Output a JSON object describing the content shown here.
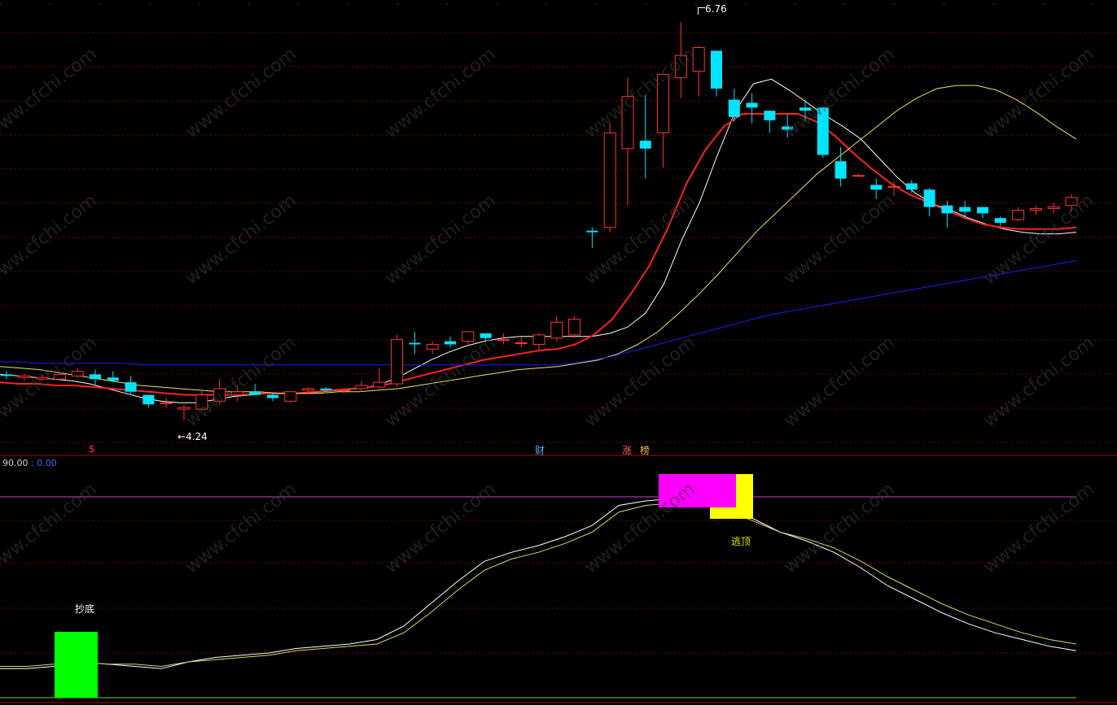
{
  "chart_data": [
    {
      "type": "candlestick",
      "high_label": "6.76",
      "low_label": "4.24",
      "moving_averages": [
        {
          "color": "#ffffff",
          "values": [
            4.53,
            4.52,
            4.51,
            4.5,
            4.49,
            4.47,
            4.44,
            4.41,
            4.38,
            4.36,
            4.35,
            4.35,
            4.37,
            4.39,
            4.4,
            4.41,
            4.41,
            4.41,
            4.42,
            4.43,
            4.44,
            4.46,
            4.5,
            4.56,
            4.62,
            4.67,
            4.71,
            4.74,
            4.76,
            4.77,
            4.77,
            4.77,
            4.77,
            4.77,
            4.79,
            4.83,
            4.92,
            5.1,
            5.38,
            5.62,
            5.92,
            6.2,
            6.37,
            6.4,
            6.33,
            6.25,
            6.17,
            6.1,
            6.02,
            5.9,
            5.78,
            5.68,
            5.61,
            5.57,
            5.52,
            5.48,
            5.45,
            5.43,
            5.42,
            5.42,
            5.43
          ]
        },
        {
          "color": "#ff2020",
          "values": [
            4.48,
            4.47,
            4.47,
            4.46,
            4.46,
            4.45,
            4.44,
            4.43,
            4.42,
            4.41,
            4.4,
            4.4,
            4.4,
            4.4,
            4.41,
            4.41,
            4.41,
            4.42,
            4.43,
            4.44,
            4.45,
            4.47,
            4.5,
            4.53,
            4.56,
            4.59,
            4.62,
            4.64,
            4.66,
            4.68,
            4.69,
            4.72,
            4.78,
            4.88,
            5.04,
            5.22,
            5.46,
            5.74,
            5.95,
            6.1,
            6.18,
            6.18,
            6.18,
            6.18,
            6.13,
            6.04,
            5.93,
            5.83,
            5.74,
            5.67,
            5.62,
            5.57,
            5.52,
            5.48,
            5.46,
            5.45,
            5.45,
            5.45,
            5.46
          ]
        },
        {
          "color": "#e8e860",
          "values": [
            4.58,
            4.57,
            4.56,
            4.54,
            4.52,
            4.5,
            4.48,
            4.46,
            4.45,
            4.44,
            4.43,
            4.42,
            4.42,
            4.42,
            4.41,
            4.41,
            4.41,
            4.42,
            4.42,
            4.43,
            4.44,
            4.46,
            4.48,
            4.5,
            4.52,
            4.54,
            4.56,
            4.57,
            4.58,
            4.6,
            4.62,
            4.66,
            4.72,
            4.8,
            4.91,
            5.03,
            5.16,
            5.3,
            5.44,
            5.56,
            5.68,
            5.8,
            5.9,
            6.0,
            6.1,
            6.2,
            6.28,
            6.34,
            6.36,
            6.36,
            6.33,
            6.27,
            6.19,
            6.1,
            6.02
          ]
        },
        {
          "color": "#1a1aff",
          "values": [
            4.61,
            4.61,
            4.6,
            4.6,
            4.6,
            4.6,
            4.6,
            4.6,
            4.59,
            4.59,
            4.59,
            4.59,
            4.59,
            4.59,
            4.59,
            4.59,
            4.59,
            4.59,
            4.59,
            4.59,
            4.59,
            4.59,
            4.59,
            4.59,
            4.59,
            4.59,
            4.59,
            4.59,
            4.59,
            4.59,
            4.59,
            4.59,
            4.6,
            4.62,
            4.64,
            4.67,
            4.7,
            4.73,
            4.76,
            4.79,
            4.82,
            4.85,
            4.88,
            4.91,
            4.93,
            4.95,
            4.97,
            4.99,
            5.01,
            5.03,
            5.05,
            5.07,
            5.09,
            5.11,
            5.13,
            5.15,
            5.17,
            5.19,
            5.21,
            5.23,
            5.25
          ]
        }
      ],
      "candles": [
        {
          "o": 4.53,
          "h": 4.55,
          "l": 4.5,
          "c": 4.52
        },
        {
          "o": 4.51,
          "h": 4.53,
          "l": 4.49,
          "c": 4.52
        },
        {
          "o": 4.5,
          "h": 4.53,
          "l": 4.49,
          "c": 4.51
        },
        {
          "o": 4.5,
          "h": 4.54,
          "l": 4.49,
          "c": 4.53
        },
        {
          "o": 4.52,
          "h": 4.57,
          "l": 4.51,
          "c": 4.55
        },
        {
          "o": 4.53,
          "h": 4.56,
          "l": 4.46,
          "c": 4.5
        },
        {
          "o": 4.51,
          "h": 4.55,
          "l": 4.48,
          "c": 4.49
        },
        {
          "o": 4.48,
          "h": 4.52,
          "l": 4.4,
          "c": 4.42
        },
        {
          "o": 4.4,
          "h": 4.4,
          "l": 4.32,
          "c": 4.34
        },
        {
          "o": 4.35,
          "h": 4.38,
          "l": 4.32,
          "c": 4.35
        },
        {
          "o": 4.31,
          "h": 4.34,
          "l": 4.24,
          "c": 4.32
        },
        {
          "o": 4.31,
          "h": 4.43,
          "l": 4.3,
          "c": 4.4
        },
        {
          "o": 4.36,
          "h": 4.5,
          "l": 4.34,
          "c": 4.44
        },
        {
          "o": 4.4,
          "h": 4.46,
          "l": 4.36,
          "c": 4.42
        },
        {
          "o": 4.42,
          "h": 4.47,
          "l": 4.4,
          "c": 4.4
        },
        {
          "o": 4.4,
          "h": 4.41,
          "l": 4.36,
          "c": 4.38
        },
        {
          "o": 4.36,
          "h": 4.42,
          "l": 4.35,
          "c": 4.42
        },
        {
          "o": 4.43,
          "h": 4.45,
          "l": 4.4,
          "c": 4.44
        },
        {
          "o": 4.44,
          "h": 4.45,
          "l": 4.42,
          "c": 4.43
        },
        {
          "o": 4.43,
          "h": 4.43,
          "l": 4.41,
          "c": 4.43
        },
        {
          "o": 4.44,
          "h": 4.49,
          "l": 4.42,
          "c": 4.46
        },
        {
          "o": 4.45,
          "h": 4.57,
          "l": 4.44,
          "c": 4.48
        },
        {
          "o": 4.47,
          "h": 4.78,
          "l": 4.45,
          "c": 4.75
        },
        {
          "o": 4.73,
          "h": 4.8,
          "l": 4.66,
          "c": 4.72
        },
        {
          "o": 4.69,
          "h": 4.74,
          "l": 4.66,
          "c": 4.72
        },
        {
          "o": 4.74,
          "h": 4.77,
          "l": 4.7,
          "c": 4.72
        },
        {
          "o": 4.74,
          "h": 4.8,
          "l": 4.72,
          "c": 4.8
        },
        {
          "o": 4.79,
          "h": 4.79,
          "l": 4.74,
          "c": 4.76
        },
        {
          "o": 4.75,
          "h": 4.79,
          "l": 4.72,
          "c": 4.75
        },
        {
          "o": 4.73,
          "h": 4.77,
          "l": 4.7,
          "c": 4.73
        },
        {
          "o": 4.72,
          "h": 4.79,
          "l": 4.68,
          "c": 4.78
        },
        {
          "o": 4.76,
          "h": 4.9,
          "l": 4.74,
          "c": 4.86
        },
        {
          "o": 4.78,
          "h": 4.9,
          "l": 4.76,
          "c": 4.88
        },
        {
          "o": 5.44,
          "h": 5.46,
          "l": 5.33,
          "c": 5.43
        },
        {
          "o": 5.46,
          "h": 6.12,
          "l": 5.43,
          "c": 6.06
        },
        {
          "o": 5.96,
          "h": 6.41,
          "l": 5.6,
          "c": 6.29
        },
        {
          "o": 6.01,
          "h": 6.3,
          "l": 5.77,
          "c": 5.96
        },
        {
          "o": 6.06,
          "h": 6.4,
          "l": 5.84,
          "c": 6.43
        },
        {
          "o": 6.41,
          "h": 6.76,
          "l": 6.28,
          "c": 6.55
        },
        {
          "o": 6.45,
          "h": 6.61,
          "l": 6.29,
          "c": 6.6
        },
        {
          "o": 6.58,
          "h": 6.58,
          "l": 6.29,
          "c": 6.34
        },
        {
          "o": 6.27,
          "h": 6.34,
          "l": 6.13,
          "c": 6.16
        },
        {
          "o": 6.25,
          "h": 6.31,
          "l": 6.12,
          "c": 6.22
        },
        {
          "o": 6.2,
          "h": 6.2,
          "l": 6.06,
          "c": 6.14
        },
        {
          "o": 6.1,
          "h": 6.18,
          "l": 6.03,
          "c": 6.08
        },
        {
          "o": 6.22,
          "h": 6.27,
          "l": 6.13,
          "c": 6.2
        },
        {
          "o": 6.22,
          "h": 6.22,
          "l": 5.9,
          "c": 5.92
        },
        {
          "o": 5.88,
          "h": 5.97,
          "l": 5.72,
          "c": 5.77
        },
        {
          "o": 5.79,
          "h": 5.8,
          "l": 5.78,
          "c": 5.79
        },
        {
          "o": 5.73,
          "h": 5.77,
          "l": 5.64,
          "c": 5.7
        },
        {
          "o": 5.72,
          "h": 5.75,
          "l": 5.66,
          "c": 5.72
        },
        {
          "o": 5.74,
          "h": 5.76,
          "l": 5.68,
          "c": 5.7
        },
        {
          "o": 5.7,
          "h": 5.71,
          "l": 5.53,
          "c": 5.59
        },
        {
          "o": 5.6,
          "h": 5.63,
          "l": 5.46,
          "c": 5.55
        },
        {
          "o": 5.59,
          "h": 5.63,
          "l": 5.52,
          "c": 5.56
        },
        {
          "o": 5.59,
          "h": 5.59,
          "l": 5.52,
          "c": 5.55
        },
        {
          "o": 5.52,
          "h": 5.53,
          "l": 5.47,
          "c": 5.49
        },
        {
          "o": 5.51,
          "h": 5.59,
          "l": 5.5,
          "c": 5.57
        },
        {
          "o": 5.57,
          "h": 5.6,
          "l": 5.54,
          "c": 5.58
        },
        {
          "o": 5.58,
          "h": 5.62,
          "l": 5.55,
          "c": 5.59
        },
        {
          "o": 5.6,
          "h": 5.67,
          "l": 5.56,
          "c": 5.65
        }
      ]
    },
    {
      "type": "line",
      "value_labels": [
        "90.00",
        ": 0.00"
      ],
      "ylim": [
        0,
        100
      ],
      "reference_line": 90,
      "series": [
        {
          "color": "#ffffff",
          "values": [
            13,
            13,
            14,
            16,
            15,
            14,
            13,
            16,
            18,
            19,
            20,
            22,
            23,
            24,
            26,
            32,
            42,
            52,
            61,
            65,
            68,
            72,
            77,
            86,
            88,
            89,
            88,
            85,
            80,
            74,
            70,
            65,
            58,
            50,
            44,
            38,
            33,
            29,
            26,
            23,
            21
          ]
        },
        {
          "color": "#d8d860",
          "values": [
            14,
            14,
            15,
            16,
            15,
            15,
            14,
            16,
            17,
            18,
            19,
            21,
            22,
            23,
            24,
            29,
            38,
            48,
            57,
            62,
            65,
            69,
            74,
            83,
            86,
            87,
            87,
            84,
            79,
            74,
            71,
            67,
            61,
            54,
            48,
            42,
            37,
            33,
            29,
            26,
            24
          ]
        }
      ],
      "annotations": [
        {
          "text": "抄底",
          "color": "#ffffff"
        },
        {
          "text": "逃顶",
          "color": "#e0e000"
        }
      ]
    }
  ],
  "markers": [
    {
      "text": "$",
      "color": "#ff3030"
    },
    {
      "text": "财",
      "color": "#5fa8ff"
    },
    {
      "text": "涨",
      "color": "#ff5a5a"
    },
    {
      "text": "榜",
      "color": "#ffb050"
    }
  ],
  "watermark": "www.cfchi.com",
  "colors": {
    "up": "#ff3333",
    "down": "#00e5ff",
    "grid": "#7a0000",
    "divider": "#b00000",
    "signal_bottom": "#00ff00",
    "signal_top_a": "#ff00ff",
    "signal_top_b": "#ffff00"
  }
}
